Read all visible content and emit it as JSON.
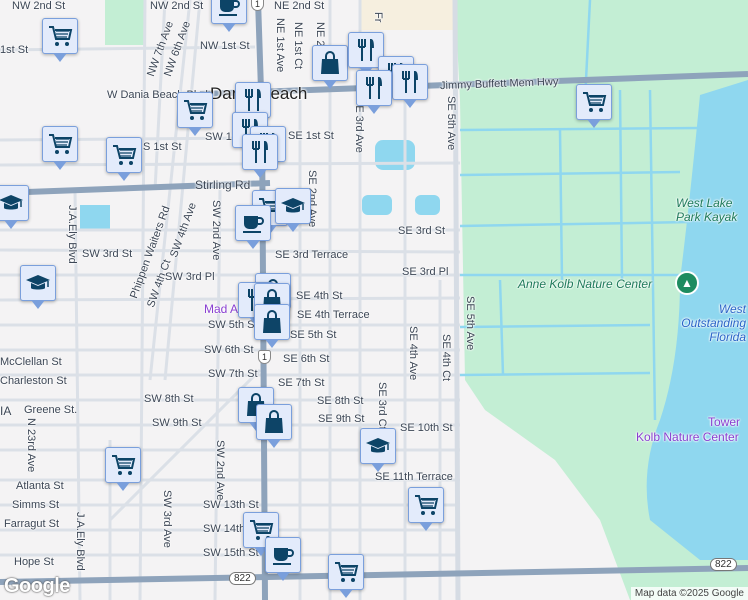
{
  "colors": {
    "land": "#f4f3f4",
    "park": "#c3eed4",
    "water": "#8fd7ef",
    "road": "#d6dce4",
    "highway": "#8ea3bb",
    "marker_bg": "#e3ebfb",
    "marker_border": "#7a9fdc",
    "icon": "#0d4467"
  },
  "city_label": "Dania Beach",
  "streets": {
    "nw2": "NW 2nd St",
    "nw2b": "NW 2nd St",
    "ne2": "NE 2nd St",
    "st1w": "1st St",
    "nw1": "NW 1st St",
    "nw7": "NW 7th Ave",
    "nw6": "NW 6th Ave",
    "ne1ave": "NE 1st Ave",
    "ne1ct": "NE 1st Ct",
    "ne2ave": "NE 2nd Ave",
    "wdania": "W Dania Beach Blvd",
    "fr": "Fr",
    "jimmy": "Jimmy Buffett Mem Hwy",
    "se3ave": "SE 3rd Ave",
    "se5ave": "SE 5th Ave",
    "sw1": "SW 1st St",
    "se1": "SE 1st St",
    "s1": "S 1st St",
    "stirling": "Stirling Rd",
    "se2": "SE 2nd Ave",
    "jaely": "J.A.Ely Blvd",
    "phippen": "Phippen Waiters Rd",
    "sw4ave": "SW 4th Ave",
    "sw4ct": "SW 4th Ct",
    "sw2ave": "SW 2nd Ave",
    "sw3st": "SW 3rd St",
    "se3terr": "SE 3rd Terrace",
    "se3st": "SE 3rd St",
    "sw3pl": "SW 3rd Pl",
    "se3pl": "SE 3rd Pl",
    "se4st": "SE 4th St",
    "se4terr": "SE 4th Terrace",
    "sw5": "SW 5th St",
    "se5": "SE 5th St",
    "sw6": "SW 6th St",
    "se6": "SE 6th St",
    "mcclellan": "McClellan St",
    "sw7": "SW 7th St",
    "se7": "SE 7th St",
    "charleston": "Charleston St",
    "se4ave": "SE 4th Ave",
    "se4ct": "SE 4th Ct",
    "sw8": "SW 8th St",
    "se8": "SE 8th St",
    "greene": "Greene St.",
    "ia": "IA",
    "se3ct": "SE 3rd Ct",
    "sw9": "SW 9th St",
    "se9": "SE 9th St",
    "se10": "SE 10th St",
    "n23": "N 23rd Ave",
    "se11terr": "SE 11th Terrace",
    "atlanta": "Atlanta St",
    "sw3ave": "SW 3rd Ave",
    "sw2ave2": "SW 2nd Ave",
    "simms": "Simms St",
    "sw13": "SW 13th St",
    "farragut": "Farragut St",
    "sw14": "SW 14th St",
    "jaely2": "J.A.Ely Blvd",
    "hope": "Hope St",
    "sw15": "SW 15th St",
    "se5ave2": "SE 5th Ave"
  },
  "places": {
    "anne": "Anne Kolb Nature Center",
    "kayak": "West Lake Park Kayak",
    "outstanding": "West Outstanding Florida",
    "tower": "Tower",
    "kolb": "Kolb Nature Center",
    "mad": "Mad Arts"
  },
  "shields": {
    "us1_top": "1",
    "us1_mid": "1",
    "sr822_left": "822",
    "sr822_right": "822"
  },
  "markers": [
    {
      "type": "coffee"
    },
    {
      "type": "cart"
    },
    {
      "type": "bag"
    },
    {
      "type": "restaurant"
    },
    {
      "type": "restaurant"
    },
    {
      "type": "restaurant"
    },
    {
      "type": "restaurant"
    },
    {
      "type": "restaurant"
    },
    {
      "type": "restaurant"
    },
    {
      "type": "restaurant"
    },
    {
      "type": "restaurant"
    },
    {
      "type": "cart"
    },
    {
      "type": "cart"
    },
    {
      "type": "cart"
    },
    {
      "type": "cart"
    },
    {
      "type": "school"
    },
    {
      "type": "cart"
    },
    {
      "type": "school"
    },
    {
      "type": "coffee"
    },
    {
      "type": "school"
    },
    {
      "type": "bag"
    },
    {
      "type": "restaurant"
    },
    {
      "type": "bag"
    },
    {
      "type": "bag"
    },
    {
      "type": "bag"
    },
    {
      "type": "bag"
    },
    {
      "type": "school"
    },
    {
      "type": "cart"
    },
    {
      "type": "cart"
    },
    {
      "type": "cart"
    },
    {
      "type": "coffee"
    },
    {
      "type": "cart"
    }
  ],
  "google_logo": "Google",
  "attribution": "Map data ©2025 Google"
}
